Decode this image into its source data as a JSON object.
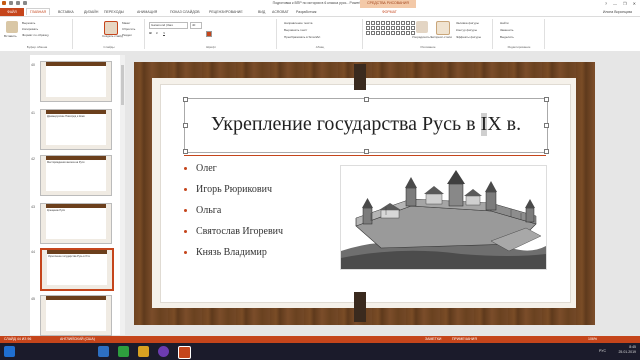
{
  "window": {
    "title": "Подготовка к ВПР по истории в 6 класса русь - PowerPoint",
    "context_group": "СРЕДСТВА РИСОВАНИЯ",
    "user": "Илона Воронцова",
    "controls": [
      "?",
      "—",
      "❐",
      "✕"
    ]
  },
  "menu": {
    "file": "ФАЙЛ",
    "tabs": [
      "ГЛАВНАЯ",
      "ВСТАВКА",
      "ДИЗАЙН",
      "ПЕРЕХОДЫ",
      "АНИМАЦИЯ",
      "ПОКАЗ СЛАЙДОВ",
      "РЕЦЕНЗИРОВАНИЕ",
      "ВИД",
      "ACROBAT",
      "Разработчик",
      "ФОРМАТ"
    ]
  },
  "ribbon": {
    "clipboard": {
      "label": "Буфер обмена",
      "paste": "Вставить",
      "cut": "Вырезать",
      "copy": "Копировать",
      "format_painter": "Формат по образцу"
    },
    "slides": {
      "label": "Слайды",
      "new_slide": "Создать слайд",
      "layout": "Макет",
      "reset": "Сбросить",
      "section": "Раздел"
    },
    "font": {
      "label": "Шрифт",
      "font_name": "Garamond (Заго",
      "font_size": "40"
    },
    "paragraph": {
      "label": "Абзац",
      "text_direction": "Направление текста",
      "align_text": "Выровнять текст",
      "smartart": "Преобразовать в SmartArt"
    },
    "drawing": {
      "label": "Рисование",
      "arrange": "Упорядочить",
      "quick_styles": "Экспресс-стили"
    },
    "shape_format": {
      "fill": "Заливка фигуры",
      "outline": "Контур фигуры",
      "effects": "Эффекты фигуры"
    },
    "editing": {
      "label": "Редактирование",
      "find": "Найти",
      "replace": "Заменить",
      "select": "Выделить"
    }
  },
  "thumbnails": [
    {
      "num": "40",
      "title": ""
    },
    {
      "num": "41",
      "title": "Древнерусские Новгород и Киев"
    },
    {
      "num": "42",
      "title": "Месторождения железа на Руси"
    },
    {
      "num": "43",
      "title": "Крещение Руси"
    },
    {
      "num": "44",
      "title": "Укрепление государства Русь в IX в."
    },
    {
      "num": "45",
      "title": ""
    }
  ],
  "slide": {
    "title_before": "Укрепление государства Русь в ",
    "title_cursor": "I",
    "title_after": "X в.",
    "bullets": [
      "Олег",
      "Игорь Рюрикович",
      "Ольга",
      "Святослав Игоревич",
      "Князь Владимир"
    ]
  },
  "status": {
    "slide_info": "СЛАЙД 44 ИЗ 96",
    "language": "АНГЛИЙСКИЙ (США)",
    "notes": "ЗАМЕТКИ",
    "comments": "ПРИМЕЧАНИЯ",
    "zoom": "106%"
  },
  "tray": {
    "time": "8:45",
    "date": "25.01.2019",
    "lang": "РУС"
  },
  "colors": {
    "accent": "#c5451b",
    "wood": "#6e4422",
    "taskbar": "#1b1b2b"
  }
}
